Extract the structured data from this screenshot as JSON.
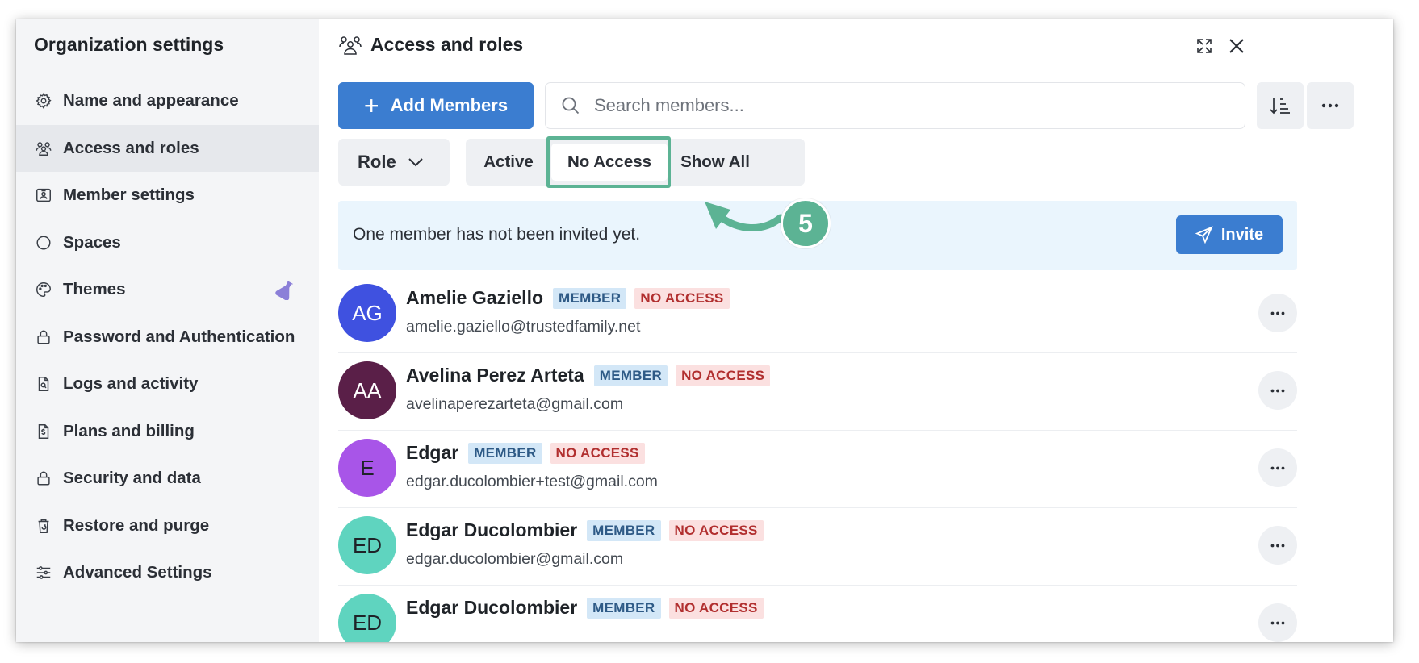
{
  "sidebar": {
    "title": "Organization settings",
    "items": [
      {
        "label": "Name and appearance",
        "icon": "gear-icon"
      },
      {
        "label": "Access and roles",
        "icon": "people-icon",
        "active": true
      },
      {
        "label": "Member settings",
        "icon": "id-card-icon"
      },
      {
        "label": "Spaces",
        "icon": "circle-icon"
      },
      {
        "label": "Themes",
        "icon": "palette-icon"
      },
      {
        "label": "Password and Authentication",
        "icon": "lock-icon"
      },
      {
        "label": "Logs and activity",
        "icon": "file-search-icon"
      },
      {
        "label": "Plans and billing",
        "icon": "receipt-icon"
      },
      {
        "label": "Security and data",
        "icon": "lock-icon"
      },
      {
        "label": "Restore and purge",
        "icon": "trash-restore-icon"
      },
      {
        "label": "Advanced Settings",
        "icon": "sliders-icon"
      }
    ]
  },
  "header": {
    "title": "Access and roles",
    "icon": "people-icon"
  },
  "toolbar": {
    "add_members_label": "Add Members",
    "search_placeholder": "Search members...",
    "sort_icon": "sort-icon",
    "more_icon": "more-icon"
  },
  "filters": {
    "role_label": "Role",
    "tabs": [
      {
        "label": "Active"
      },
      {
        "label": "No Access",
        "selected": true
      },
      {
        "label": "Show All"
      }
    ]
  },
  "annotation": {
    "step": "5",
    "color": "#5cb394"
  },
  "banner": {
    "text": "One member has not been invited yet.",
    "invite_label": "Invite"
  },
  "members": [
    {
      "initials": "AG",
      "name": "Amelie Gaziello",
      "role": "MEMBER",
      "status": "NO ACCESS",
      "email": "amelie.gaziello@trustedfamily.net",
      "color": "#3f51e0"
    },
    {
      "initials": "AA",
      "name": "Avelina Perez Arteta",
      "role": "MEMBER",
      "status": "NO ACCESS",
      "email": "avelinaperezarteta@gmail.com",
      "color": "#5a1f48"
    },
    {
      "initials": "E",
      "name": "Edgar",
      "role": "MEMBER",
      "status": "NO ACCESS",
      "email": "edgar.ducolombier+test@gmail.com",
      "color": "#a855e8"
    },
    {
      "initials": "ED",
      "name": "Edgar Ducolombier",
      "role": "MEMBER",
      "status": "NO ACCESS",
      "email": "edgar.ducolombier@gmail.com",
      "color": "#5fd4bf"
    },
    {
      "initials": "ED",
      "name": "Edgar Ducolombier",
      "role": "MEMBER",
      "status": "NO ACCESS",
      "email": "",
      "color": "#5fd4bf"
    }
  ],
  "colors": {
    "accent": "#3b7dd0",
    "sidebar_bg": "#f4f5f7",
    "member_badge_bg": "#d3e7f7",
    "no_access_badge_bg": "#fbe0e0"
  }
}
